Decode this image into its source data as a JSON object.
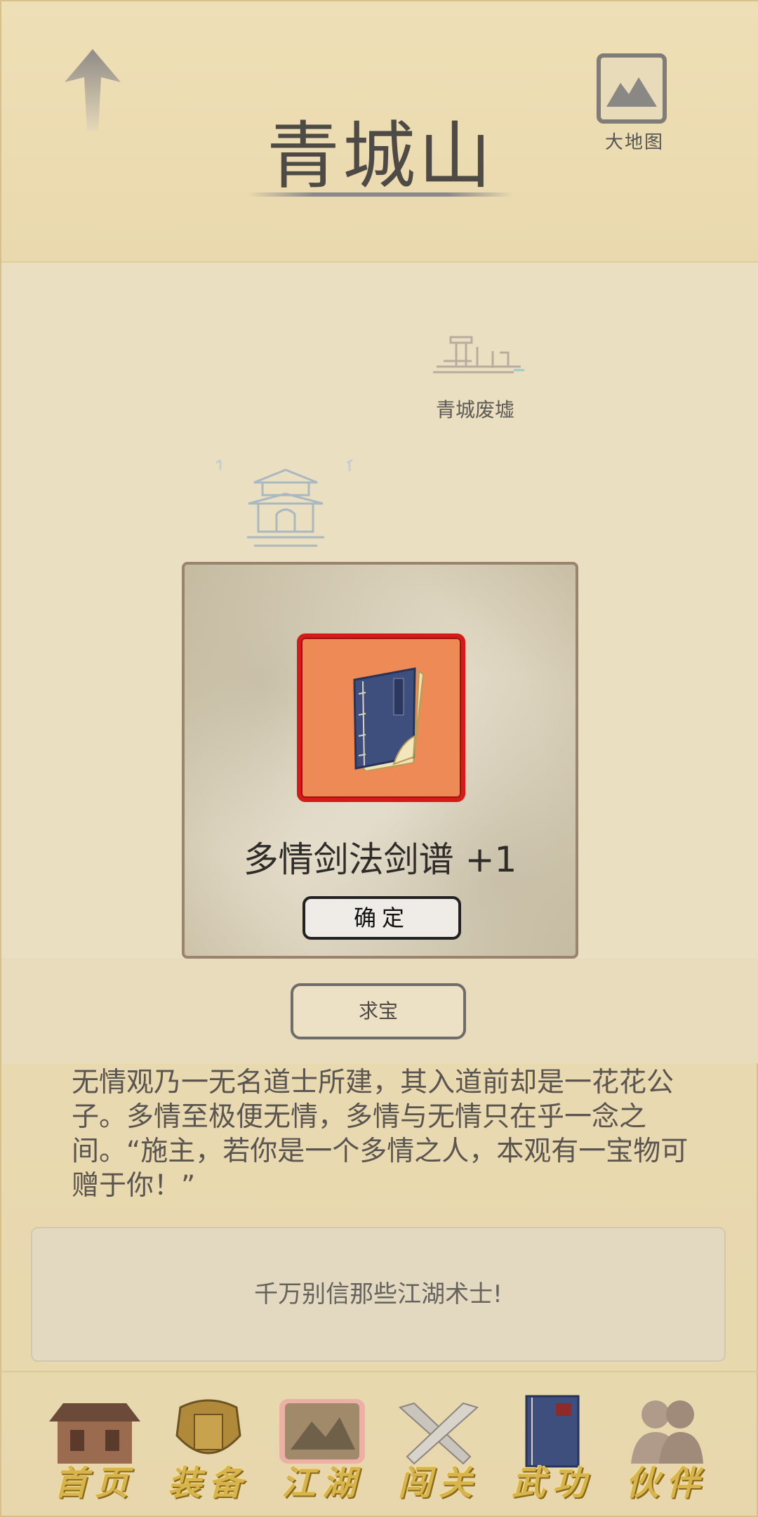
{
  "header": {
    "title": "青城山",
    "map_label": "大地图"
  },
  "map": {
    "location_label": "青城废墟"
  },
  "popup": {
    "reward_text": "多情剑法剑谱 +1",
    "confirm_label": "确定",
    "item_icon": "book-icon",
    "item_frame_color": "#ee8a55"
  },
  "seek_button_label": "求宝",
  "story_text": "无情观乃一无名道士所建，其入道前却是一花花公子。多情至极便无情，多情与无情只在乎一念之间。“施主，若你是一个多情之人，本观有一宝物可赠于你！”",
  "tip_text": "千万别信那些江湖术士!",
  "nav": {
    "items": [
      {
        "label": "首页",
        "icon": "house-icon"
      },
      {
        "label": "装备",
        "icon": "armor-icon"
      },
      {
        "label": "江湖",
        "icon": "scroll-map-icon"
      },
      {
        "label": "闯关",
        "icon": "crossed-swords-icon"
      },
      {
        "label": "武功",
        "icon": "book-icon"
      },
      {
        "label": "伙伴",
        "icon": "people-icon"
      }
    ],
    "active_index": 2,
    "label_color": "#d8b54c"
  }
}
